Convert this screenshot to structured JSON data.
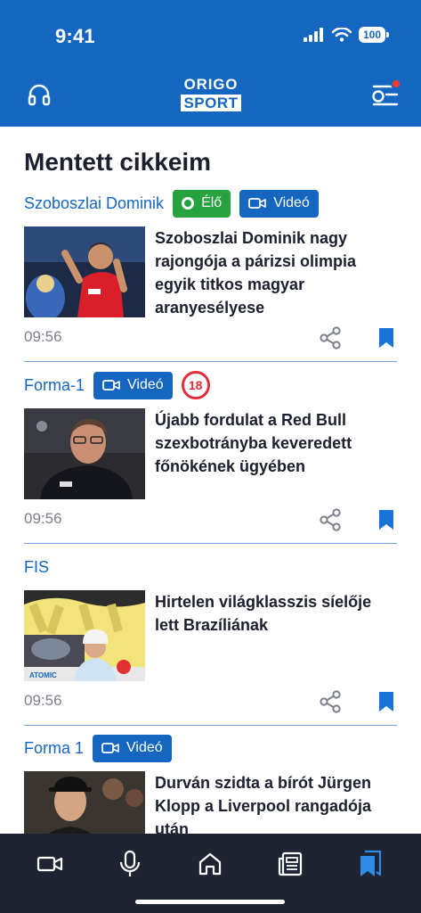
{
  "status": {
    "time": "9:41",
    "battery": "100"
  },
  "header": {
    "logo_top": "ORIGO",
    "logo_bottom": "SPORT",
    "left_icon": "headphones-icon",
    "right_icon": "menu-filter-icon"
  },
  "page": {
    "title": "Mentett cikkeim"
  },
  "colors": {
    "brand": "#1466c0",
    "live": "#26a33f",
    "age": "#e42c3c",
    "nav": "#1f2433"
  },
  "articles": [
    {
      "category": "Szoboszlai Dominik",
      "live_label": "Élő",
      "video_label": "Videó",
      "headline": "Szoboszlai Dominik nagy rajongója a párizsi olimpia egyik titkos magyar aranyesélyese",
      "time": "09:56"
    },
    {
      "category": "Forma-1",
      "video_label": "Videó",
      "age_label": "18",
      "headline": "Újabb fordulat a Red Bull szexbotrányba keveredett főnökének ügyében",
      "time": "09:56"
    },
    {
      "category": "FIS",
      "headline": "Hirtelen világklasszis síelője lett Brazíliának",
      "time": "09:56"
    },
    {
      "category": "Forma 1",
      "video_label": "Videó",
      "headline": "Durván szidta a bírót Jürgen Klopp a Liverpool rangadója után"
    }
  ],
  "nav": [
    "video-icon",
    "microphone-icon",
    "home-icon",
    "newspaper-icon",
    "bookmarks-icon"
  ]
}
